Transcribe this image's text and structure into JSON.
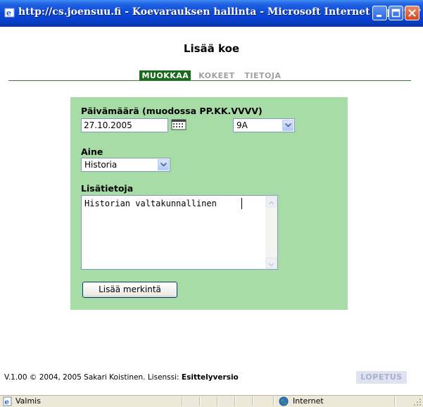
{
  "window": {
    "title": "http://cs.joensuu.fi - Koevarauksen hallinta - Microsoft Internet Explorer"
  },
  "page": {
    "heading": "Lisää koe",
    "tabs": [
      {
        "label": "MUOKKAA",
        "active": true
      },
      {
        "label": "KOKEET",
        "active": false
      },
      {
        "label": "TIETOJA",
        "active": false
      }
    ]
  },
  "form": {
    "date_label": "Päivämäärä (muodossa PP.KK.VVVV)",
    "date_value": "27.10.2005",
    "class_value": "9A",
    "subject_label": "Aine",
    "subject_value": "Historia",
    "info_label": "Lisätietoja",
    "info_value": "Historian valtakunnallinen",
    "submit_label": "Lisää merkintä"
  },
  "footer": {
    "text": "V.1.00 © 2004, 2005 Sakari Koistinen. Lisenssi: ",
    "license": "Esittelyversio",
    "logout_label": "LOPETUS"
  },
  "statusbar": {
    "status": "Valmis",
    "zone": "Internet"
  },
  "colors": {
    "panel": "#a8dca6",
    "active_tab": "#1b6b1f",
    "titlebar": "#0a46d8"
  }
}
